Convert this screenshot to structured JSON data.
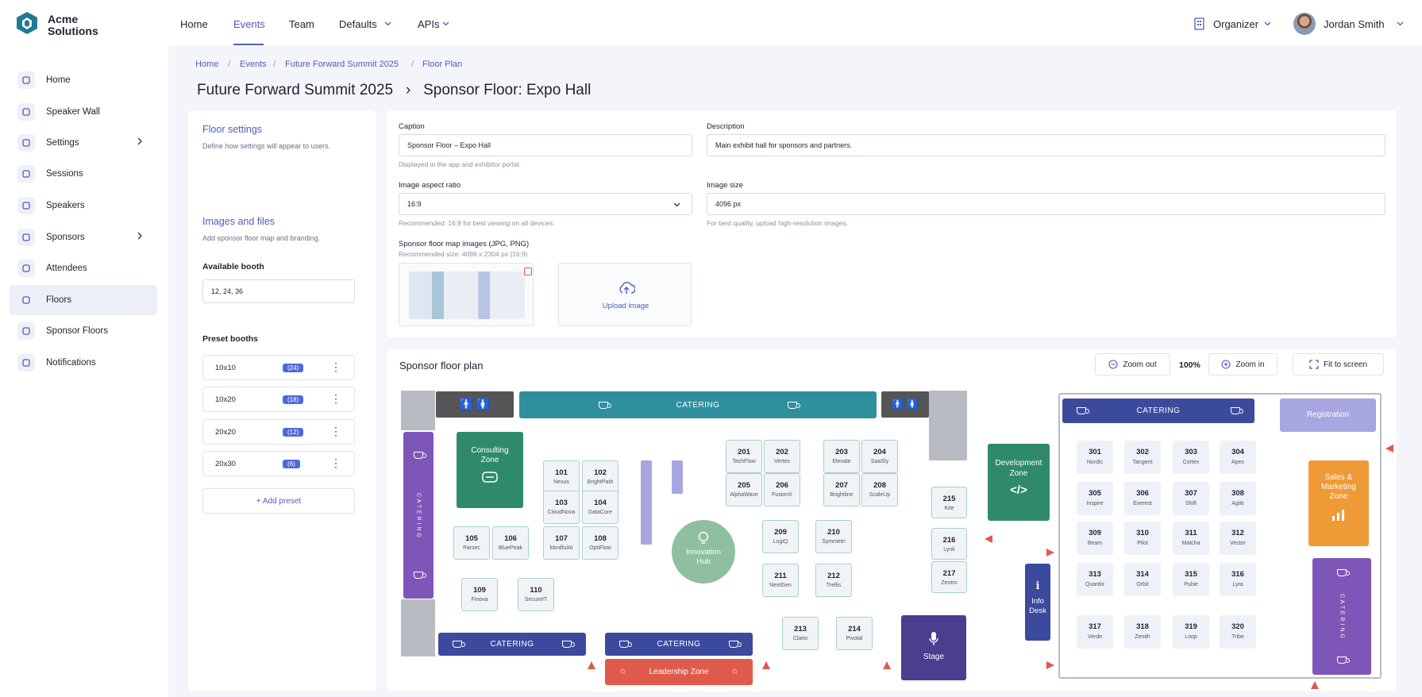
{
  "app": {
    "name_line1": "Acme",
    "name_line2": "Solutions"
  },
  "sidebar": {
    "items": [
      {
        "label": "Home",
        "icon": "home-icon"
      },
      {
        "label": "Speaker Wall",
        "icon": "megaphone-icon"
      },
      {
        "label": "Settings",
        "icon": "gear-icon"
      },
      {
        "label": "Sessions",
        "icon": "clock-icon"
      },
      {
        "label": "Speakers",
        "icon": "person-icon"
      },
      {
        "label": "Sponsors",
        "icon": "star-icon"
      },
      {
        "label": "Attendees",
        "icon": "people-icon"
      },
      {
        "label": "Floors",
        "icon": "map-icon"
      },
      {
        "label": "Sponsor Floors",
        "icon": "map-icon"
      },
      {
        "label": "Notifications",
        "icon": "bell-icon"
      }
    ],
    "active": "Floors"
  },
  "topnav": {
    "home": "Home",
    "events": "Events",
    "team": "Team",
    "defaults": "Defaults",
    "apis": "APIs",
    "role": "Organizer",
    "user": "Jordan Smith"
  },
  "breadcrumb": [
    "Home",
    "Events",
    "Future Forward Summit 2025",
    "Floor Plan"
  ],
  "heading": {
    "event": "Future Forward Summit 2025",
    "sep": "›",
    "page": "Sponsor Floor: Expo Hall"
  },
  "left": {
    "floor_title": "Floor settings",
    "floor_sub": "Define how settings will appear to users.",
    "images_title": "Images and files",
    "images_sub": "Add sponsor floor map and branding.",
    "available_label": "Available booth",
    "available_value": "12, 24, 36",
    "preset_title": "Preset booths",
    "presets": [
      {
        "name": "10x10",
        "count": "(24)"
      },
      {
        "name": "10x20",
        "count": "(18)"
      },
      {
        "name": "20x20",
        "count": "(12)"
      },
      {
        "name": "20x30",
        "count": "(6)"
      }
    ],
    "add_preset": "+ Add preset"
  },
  "form": {
    "caption_label": "Caption",
    "caption_value": "Sponsor Floor – Expo Hall",
    "caption_help": "Displayed in the app and exhibitor portal.",
    "desc_label": "Description",
    "desc_value": "Main exhibit hall for sponsors and partners.",
    "ratio_label": "Image aspect ratio",
    "ratio_value": "16:9",
    "ratio_help": "Recommended: 16:9 for best viewing on all devices.",
    "size_label": "Image size",
    "size_value": "4096 px",
    "size_help": "For best quality, upload high-resolution images.",
    "maps_label": "Sponsor floor map images (JPG, PNG)",
    "maps_help": "Recommended size: 4096 x 2304 px (16:9)",
    "upload_label": "Upload image"
  },
  "plan": {
    "title": "Sponsor floor plan",
    "zoom_out": "Zoom out",
    "zoom_level": "100%",
    "zoom_in": "Zoom in",
    "fit": "Fit to screen",
    "catering": "CATERING",
    "catering_vertical": "C A T E R I N G",
    "zones": {
      "consulting": "Consulting Zone",
      "innovation": "Innovation Hub",
      "development": "Development Zone",
      "sales": "Sales & Marketing Zone",
      "leadership": "Leadership Zone",
      "stage": "Stage",
      "info": "Info Desk",
      "registration": "Registration"
    },
    "booths_a": [
      {
        "n": "101",
        "s": "Nexus"
      },
      {
        "n": "102",
        "s": "BrightPath"
      },
      {
        "n": "103",
        "s": "CloudNova"
      },
      {
        "n": "104",
        "s": "DataCore"
      },
      {
        "n": "105",
        "s": "Parsec"
      },
      {
        "n": "106",
        "s": "BluePeak"
      },
      {
        "n": "107",
        "s": "MindfulAI"
      },
      {
        "n": "108",
        "s": "OptiFlow"
      },
      {
        "n": "109",
        "s": "Finova"
      },
      {
        "n": "110",
        "s": "SecureIT"
      }
    ],
    "booths_b": [
      {
        "n": "201",
        "s": "TechFlow"
      },
      {
        "n": "202",
        "s": "Vertex"
      },
      {
        "n": "203",
        "s": "Elevate"
      },
      {
        "n": "204",
        "s": "SaaSly"
      },
      {
        "n": "205",
        "s": "AlphaWave"
      },
      {
        "n": "206",
        "s": "FusionX"
      },
      {
        "n": "207",
        "s": "Brightline"
      },
      {
        "n": "208",
        "s": "ScaleUp"
      },
      {
        "n": "209",
        "s": "LogiQ"
      },
      {
        "n": "210",
        "s": "Symmetri"
      },
      {
        "n": "211",
        "s": "NextGen"
      },
      {
        "n": "212",
        "s": "Trellis"
      },
      {
        "n": "213",
        "s": "Clario"
      },
      {
        "n": "214",
        "s": "Pivotal"
      },
      {
        "n": "215",
        "s": "Kite"
      },
      {
        "n": "216",
        "s": "Lynk"
      },
      {
        "n": "217",
        "s": "Zentro"
      }
    ],
    "booths_c": [
      {
        "n": "301",
        "s": "Nordic"
      },
      {
        "n": "302",
        "s": "Tangent"
      },
      {
        "n": "303",
        "s": "Cortex"
      },
      {
        "n": "304",
        "s": "Apex"
      },
      {
        "n": "305",
        "s": "Inspire"
      },
      {
        "n": "306",
        "s": "Everest"
      },
      {
        "n": "307",
        "s": "Shift"
      },
      {
        "n": "308",
        "s": "Agile"
      },
      {
        "n": "309",
        "s": "Beam"
      },
      {
        "n": "310",
        "s": "Pilot"
      },
      {
        "n": "311",
        "s": "Matcha"
      },
      {
        "n": "312",
        "s": "Vector"
      },
      {
        "n": "313",
        "s": "Quantix"
      },
      {
        "n": "314",
        "s": "Orbit"
      },
      {
        "n": "315",
        "s": "Pulse"
      },
      {
        "n": "316",
        "s": "Lyra"
      },
      {
        "n": "317",
        "s": "Verde"
      },
      {
        "n": "318",
        "s": "Zenith"
      },
      {
        "n": "319",
        "s": "Loop"
      },
      {
        "n": "320",
        "s": "Tribe"
      }
    ]
  },
  "colors": {
    "accent": "#4f5bc0",
    "teal": "#2e8f9d",
    "green": "#2f8a6b",
    "purple": "#7e56b8",
    "navy": "#3c4a9e",
    "orange": "#f09a35",
    "red": "#e05a4b"
  }
}
